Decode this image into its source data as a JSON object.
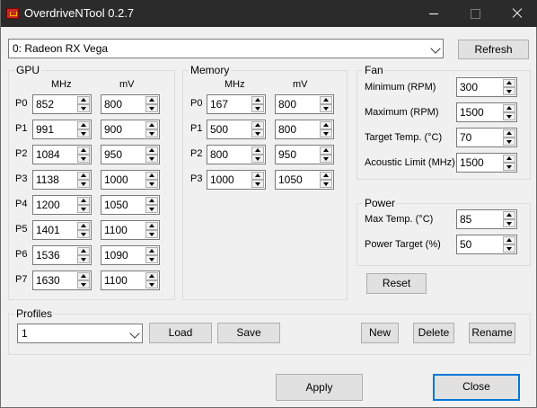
{
  "window": {
    "title": "OverdriveNTool 0.2.7"
  },
  "device": {
    "selected": "0: Radeon RX Vega",
    "refresh_label": "Refresh"
  },
  "gpu": {
    "label": "GPU",
    "col_mhz": "MHz",
    "col_mv": "mV",
    "rows": [
      {
        "state": "P0",
        "mhz": "852",
        "mv": "800"
      },
      {
        "state": "P1",
        "mhz": "991",
        "mv": "900"
      },
      {
        "state": "P2",
        "mhz": "1084",
        "mv": "950"
      },
      {
        "state": "P3",
        "mhz": "1138",
        "mv": "1000"
      },
      {
        "state": "P4",
        "mhz": "1200",
        "mv": "1050"
      },
      {
        "state": "P5",
        "mhz": "1401",
        "mv": "1100"
      },
      {
        "state": "P6",
        "mhz": "1536",
        "mv": "1090"
      },
      {
        "state": "P7",
        "mhz": "1630",
        "mv": "1100"
      }
    ]
  },
  "memory": {
    "label": "Memory",
    "col_mhz": "MHz",
    "col_mv": "mV",
    "rows": [
      {
        "state": "P0",
        "mhz": "167",
        "mv": "800"
      },
      {
        "state": "P1",
        "mhz": "500",
        "mv": "800"
      },
      {
        "state": "P2",
        "mhz": "800",
        "mv": "950"
      },
      {
        "state": "P3",
        "mhz": "1000",
        "mv": "1050"
      }
    ]
  },
  "fan": {
    "label": "Fan",
    "fields": [
      {
        "label": "Minimum (RPM)",
        "value": "300"
      },
      {
        "label": "Maximum (RPM)",
        "value": "1500"
      },
      {
        "label": "Target Temp. (°C)",
        "value": "70"
      },
      {
        "label": "Acoustic Limit (MHz)",
        "value": "1500"
      }
    ]
  },
  "power": {
    "label": "Power",
    "fields": [
      {
        "label": "Max Temp. (°C)",
        "value": "85"
      },
      {
        "label": "Power Target (%)",
        "value": "50"
      }
    ]
  },
  "reset_label": "Reset",
  "profiles": {
    "label": "Profiles",
    "selected": "1",
    "load_label": "Load",
    "save_label": "Save",
    "new_label": "New",
    "delete_label": "Delete",
    "rename_label": "Rename"
  },
  "footer": {
    "apply_label": "Apply",
    "close_label": "Close"
  },
  "icons": {
    "app": "app-logo-icon",
    "minimize": "minimize-icon",
    "maximize": "maximize-icon",
    "close": "close-icon",
    "dropdown": "chevron-down-icon",
    "spin_up": "spin-up-arrow-icon",
    "spin_down": "spin-down-arrow-icon"
  },
  "colors": {
    "titlebar": "#2b2b2b",
    "accent": "#0078d7",
    "window_bg": "#f0f0f0"
  }
}
